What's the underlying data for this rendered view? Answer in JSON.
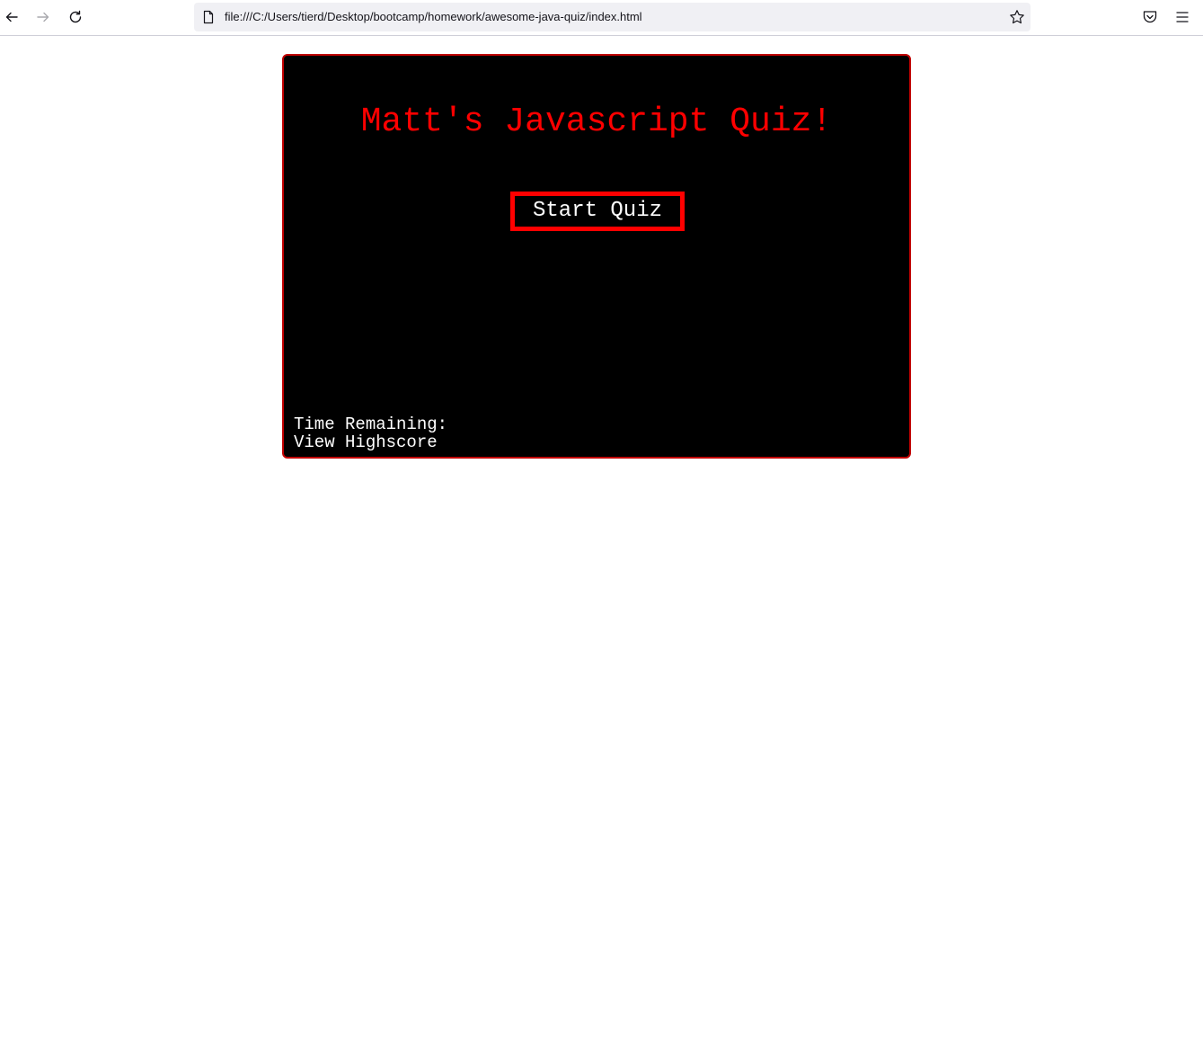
{
  "browser": {
    "url": "file:///C:/Users/tierd/Desktop/bootcamp/homework/awesome-java-quiz/index.html",
    "icons": {
      "back": "back-arrow-icon",
      "forward": "forward-arrow-icon",
      "reload": "reload-icon",
      "page": "page-icon",
      "bookmark": "star-icon",
      "pocket": "pocket-icon",
      "menu": "hamburger-menu-icon"
    }
  },
  "quiz": {
    "title": "Matt's Javascript Quiz!",
    "start_button_label": "Start Quiz",
    "time_label": "Time Remaining:",
    "highscore_label": "View Highscore",
    "colors": {
      "background": "#000000",
      "accent": "#ff0000",
      "text": "#ffffff"
    }
  }
}
